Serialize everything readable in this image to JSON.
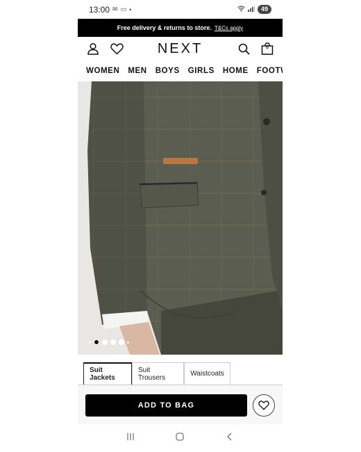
{
  "status": {
    "time": "13:00",
    "battery": "49"
  },
  "promo": {
    "text": "Free delivery & returns to store.",
    "link": "T&Cs apply"
  },
  "header": {
    "logo": "NEXT",
    "bag_count": "0"
  },
  "nav": [
    "WOMEN",
    "MEN",
    "BOYS",
    "GIRLS",
    "HOME",
    "FOOTWEAR"
  ],
  "carousel": {
    "slide_count": 7,
    "active_index": 1
  },
  "tabs": [
    "Suit Jackets",
    "Suit Trousers",
    "Waistcoats"
  ],
  "action": {
    "add_to_bag": "ADD TO BAG"
  },
  "icons": [
    "mail-icon",
    "wifi-icon",
    "signal-icon",
    "account-icon",
    "heart-icon",
    "search-icon",
    "bag-icon",
    "recents-icon",
    "home-icon",
    "back-icon"
  ],
  "colors": {
    "promo_bg": "#000000",
    "button_bg": "#000000",
    "tweed": "#5a5c4f"
  }
}
